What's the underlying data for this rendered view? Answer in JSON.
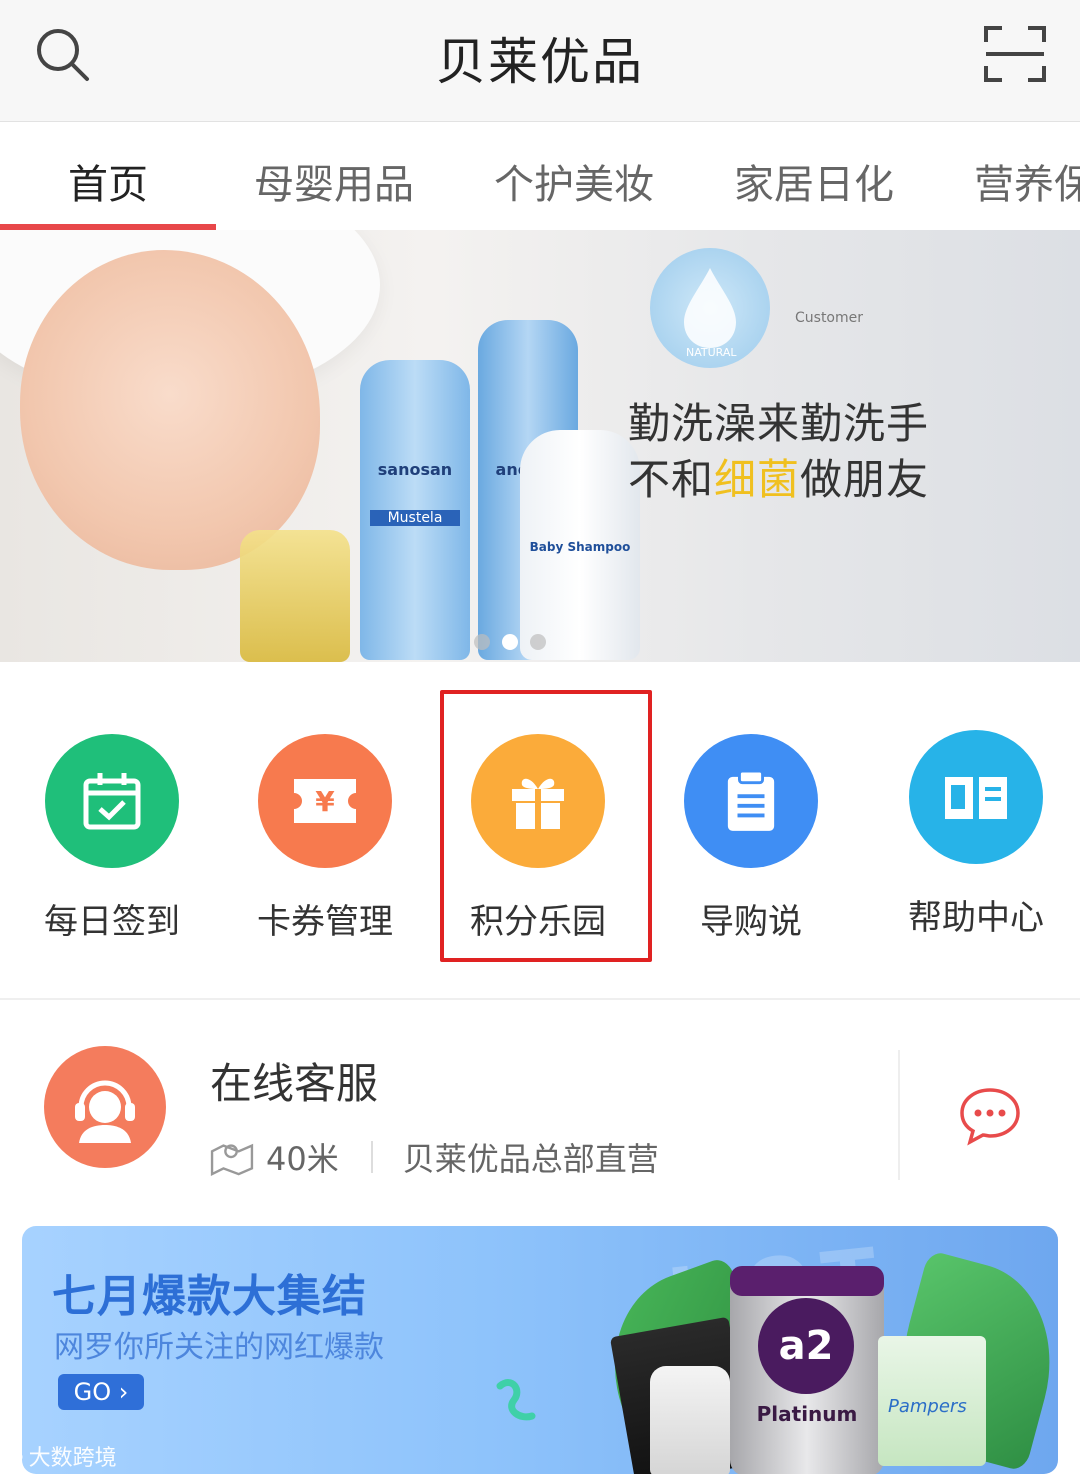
{
  "header": {
    "title": "贝莱优品"
  },
  "tabs": [
    {
      "label": "首页",
      "active": true
    },
    {
      "label": "母婴用品",
      "active": false
    },
    {
      "label": "个护美妆",
      "active": false
    },
    {
      "label": "家居日化",
      "active": false
    },
    {
      "label": "营养保",
      "active": false
    }
  ],
  "banner": {
    "brand": "Customer",
    "badge": "NATURAL",
    "line1": "勤洗澡来勤洗手",
    "line2_pre": "不和",
    "line2_highlight": "细菌",
    "line2_post": "做朋友",
    "product_labels": [
      "sanosan",
      "anosan",
      "Mustela",
      "Baby Shampoo"
    ],
    "slides_total": 3,
    "slide_active": 2
  },
  "quick_menu": [
    {
      "label": "每日签到",
      "icon": "calendar-check-icon",
      "color": "#1fbf7a"
    },
    {
      "label": "卡券管理",
      "icon": "coupon-yen-icon",
      "color": "#f77a4e"
    },
    {
      "label": "积分乐园",
      "icon": "gift-icon",
      "color": "#fbab3a",
      "highlighted": true
    },
    {
      "label": "导购说",
      "icon": "clipboard-icon",
      "color": "#3f8ef4"
    },
    {
      "label": "帮助中心",
      "icon": "book-icon",
      "color": "#27b3e8"
    }
  ],
  "service": {
    "title": "在线客服",
    "distance": "40米",
    "store": "贝莱优品总部直营"
  },
  "promo": {
    "title": "七月爆款大集结",
    "subtitle": "网罗你所关注的网红爆款",
    "cta": "GO",
    "watermark": "HOT SALE",
    "can_logo": "a2",
    "can_label": "Platinum",
    "diaper_brand": "Pampers"
  },
  "footer_watermark": "大数跨境",
  "colors": {
    "accent": "#e8474a",
    "highlight_box": "#e02222",
    "service_avatar": "#f47c5d",
    "chat_icon": "#e84b4b"
  }
}
